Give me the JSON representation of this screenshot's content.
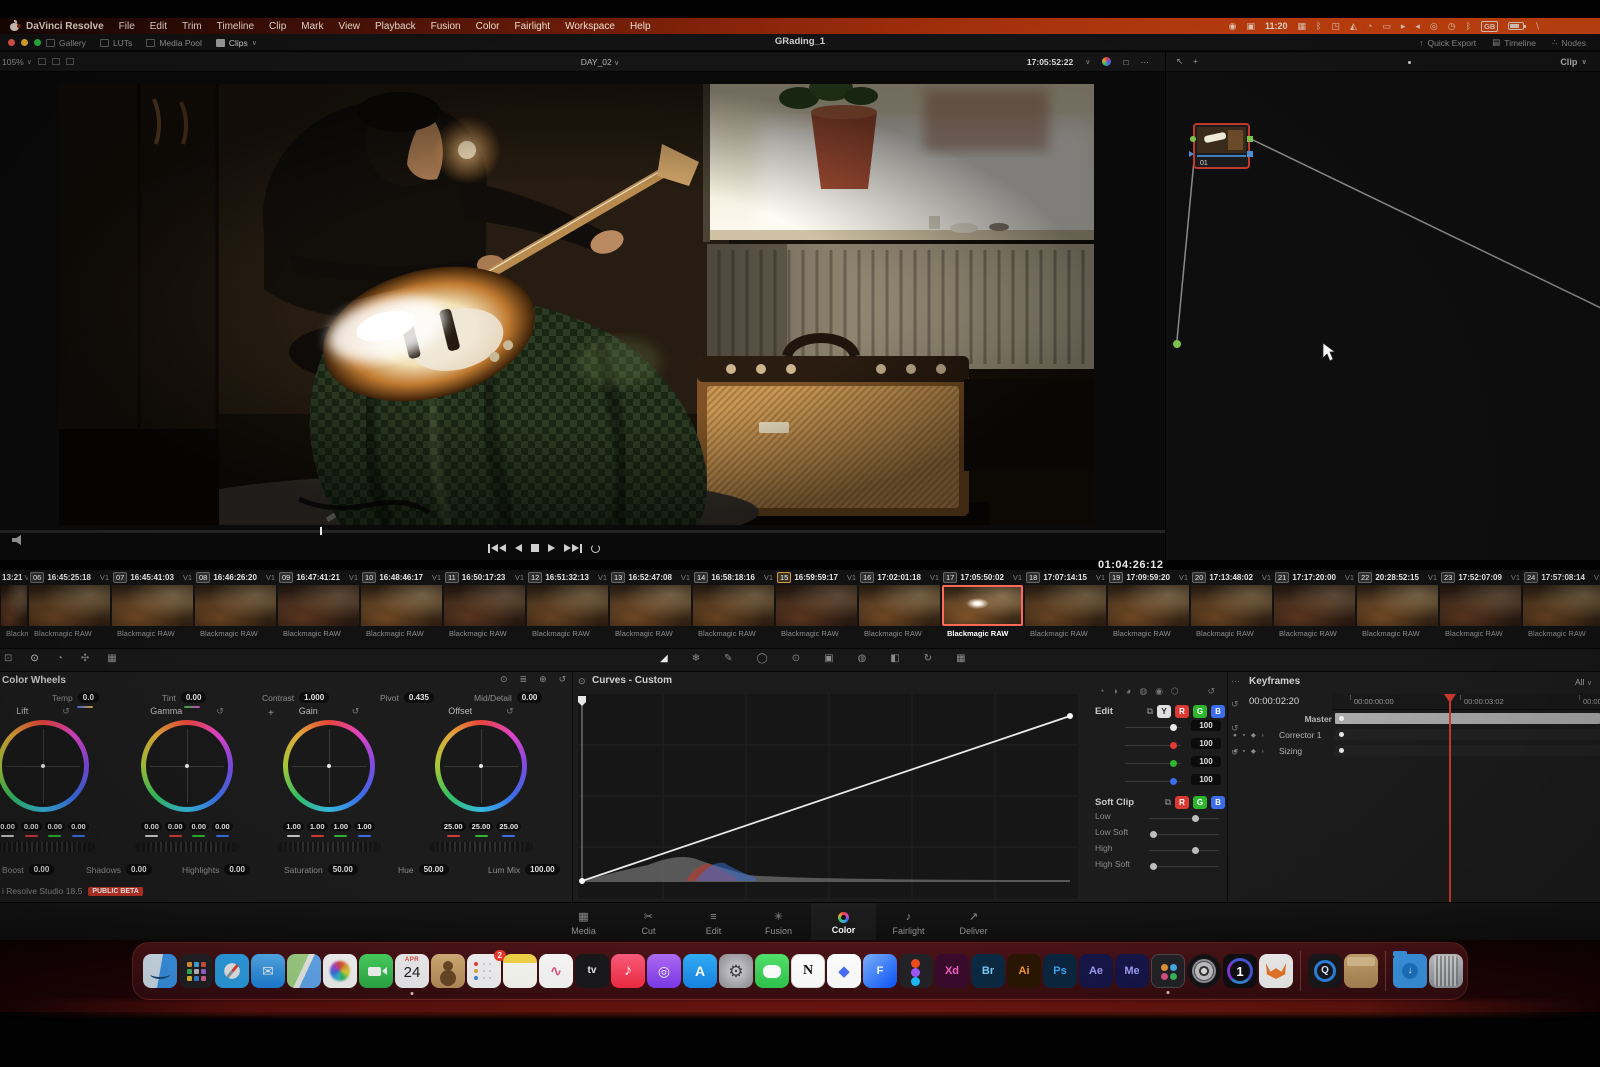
{
  "menu_bar": {
    "items": [
      "DaVinci Resolve",
      "File",
      "Edit",
      "Trim",
      "Timeline",
      "Clip",
      "Mark",
      "View",
      "Playback",
      "Fusion",
      "Color",
      "Fairlight",
      "Workspace",
      "Help"
    ],
    "status": [
      {
        "name": "creative-cloud-icon",
        "glyph": "◉"
      },
      {
        "name": "screen-record-icon",
        "glyph": "▣"
      },
      {
        "name": "menu-bar-time",
        "text": "11:20"
      },
      {
        "name": "stage-manager-icon",
        "glyph": "▦"
      },
      {
        "name": "bluetooth-icon",
        "glyph": "ᛒ"
      },
      {
        "name": "app-status-icon",
        "glyph": "◳"
      },
      {
        "name": "airdrop-icon",
        "glyph": "◭"
      },
      {
        "name": "pie-chart-icon",
        "glyph": "◔"
      },
      {
        "name": "display-icon",
        "glyph": "▭"
      },
      {
        "name": "play-status-icon",
        "glyph": "▸"
      },
      {
        "name": "volume-status-icon",
        "glyph": "◂"
      },
      {
        "name": "shortcuts-icon",
        "glyph": "◎"
      },
      {
        "name": "clock-icon",
        "glyph": "◷"
      },
      {
        "name": "bluetooth-2-icon",
        "glyph": "ᛒ"
      },
      {
        "name": "keyboard-layout",
        "text": "GB",
        "boxed": true
      },
      {
        "name": "battery-icon",
        "battery": true
      },
      {
        "name": "pen-icon",
        "glyph": "∖"
      }
    ]
  },
  "window_bar": {
    "title": "GRading_1",
    "left_buttons": [
      {
        "label": "Gallery"
      },
      {
        "label": "LUTs"
      },
      {
        "label": "Media Pool"
      },
      {
        "label": "Clips",
        "active": true,
        "dropdown": true
      }
    ],
    "right_buttons": [
      {
        "label": "Quick Export",
        "icon": "↑"
      },
      {
        "label": "Timeline",
        "icon": "▤"
      },
      {
        "label": "Nodes",
        "icon": "∴"
      }
    ]
  },
  "viewer": {
    "zoom": "105%",
    "timeline_name": "DAY_02",
    "timecode": "17:05:52:22",
    "record_timecode": "01:04:26:12"
  },
  "node_panel": {
    "header": "Clip",
    "node_label": "01"
  },
  "timeline": {
    "track": "V1",
    "format": "Blackmagic RAW",
    "clips": [
      {
        "tc": "13:21",
        "partial": true
      },
      {
        "num": "06",
        "tc": "16:45:25:18"
      },
      {
        "num": "07",
        "tc": "16:45:41:03"
      },
      {
        "num": "08",
        "tc": "16:46:26:20"
      },
      {
        "num": "09",
        "tc": "16:47:41:21"
      },
      {
        "num": "10",
        "tc": "16:48:46:17"
      },
      {
        "num": "11",
        "tc": "16:50:17:23"
      },
      {
        "num": "12",
        "tc": "16:51:32:13"
      },
      {
        "num": "13",
        "tc": "16:52:47:08"
      },
      {
        "num": "14",
        "tc": "16:58:18:16"
      },
      {
        "num": "15",
        "tc": "16:59:59:17",
        "marked": true
      },
      {
        "num": "16",
        "tc": "17:02:01:18"
      },
      {
        "num": "17",
        "tc": "17:05:50:02",
        "selected": true
      },
      {
        "num": "18",
        "tc": "17:07:14:15"
      },
      {
        "num": "19",
        "tc": "17:09:59:20"
      },
      {
        "num": "20",
        "tc": "17:13:48:02"
      },
      {
        "num": "21",
        "tc": "17:17:20:00"
      },
      {
        "num": "22",
        "tc": "20:28:52:15"
      },
      {
        "num": "23",
        "tc": "17:52:07:09"
      },
      {
        "num": "24",
        "tc": "17:57:08:14"
      }
    ]
  },
  "palette_icons": {
    "left": [
      "camera-raw",
      "color-wheels-mode",
      "hdr-wheels",
      "color-bars",
      "preview"
    ],
    "center": [
      "curves",
      "color-warper",
      "qualifier",
      "power-window",
      "tracker",
      "magic-mask",
      "blur",
      "key",
      "sizing",
      "stereo-3d"
    ]
  },
  "wheels": {
    "panel_title": "Color Wheels",
    "adjustments": [
      {
        "label": "Temp",
        "value": "0.0"
      },
      {
        "label": "Tint",
        "value": "0.00"
      },
      {
        "label": "Contrast",
        "value": "1.000"
      },
      {
        "label": "Pivot",
        "value": "0.435"
      },
      {
        "label": "Mid/Detail",
        "value": "0.00"
      }
    ],
    "wheels": [
      {
        "label": "Lift",
        "values": [
          "0.00",
          "0.00",
          "0.00",
          "0.00"
        ]
      },
      {
        "label": "Gamma",
        "values": [
          "0.00",
          "0.00",
          "0.00",
          "0.00"
        ]
      },
      {
        "label": "Gain",
        "values": [
          "1.00",
          "1.00",
          "1.00",
          "1.00"
        ]
      },
      {
        "label": "Offset",
        "values": [
          "25.00",
          "25.00",
          "25.00"
        ]
      }
    ],
    "bottom_adjustments": [
      {
        "label": "Boost",
        "value": "0.00"
      },
      {
        "label": "Shadows",
        "value": "0.00"
      },
      {
        "label": "Highlights",
        "value": "0.00"
      },
      {
        "label": "Saturation",
        "value": "50.00"
      },
      {
        "label": "Hue",
        "value": "50.00"
      },
      {
        "label": "Lum Mix",
        "value": "100.00"
      }
    ],
    "version": "i Resolve Studio 18.5",
    "beta_badge": "PUBLIC BETA"
  },
  "curves": {
    "panel_title": "Curves - Custom",
    "edit_label": "Edit",
    "channels": [
      "Y",
      "R",
      "G",
      "B"
    ],
    "channel_values": [
      "100",
      "100",
      "100",
      "100"
    ],
    "soft_clip_label": "Soft Clip",
    "soft_clip_channels": [
      "R",
      "G",
      "B"
    ],
    "soft_clip_rows": [
      {
        "label": "Low",
        "pos": 62
      },
      {
        "label": "Low Soft",
        "pos": 2
      },
      {
        "label": "High",
        "pos": 62
      },
      {
        "label": "High Soft",
        "pos": 2
      }
    ]
  },
  "keyframes": {
    "panel_title": "Keyframes",
    "filter": "All",
    "current_timecode": "00:00:02:20",
    "ruler_labels": [
      "00:00:00:00",
      "00:00:03:02",
      "00:00:0"
    ],
    "rows": [
      {
        "label": "Master",
        "master": true
      },
      {
        "label": "Corrector 1"
      },
      {
        "label": "Sizing"
      }
    ]
  },
  "pages": {
    "tabs": [
      {
        "label": "Media",
        "name": "media"
      },
      {
        "label": "Cut",
        "name": "cut"
      },
      {
        "label": "Edit",
        "name": "edit"
      },
      {
        "label": "Fusion",
        "name": "fusion"
      },
      {
        "label": "Color",
        "name": "color",
        "active": true
      },
      {
        "label": "Fairlight",
        "name": "fairlight"
      },
      {
        "label": "Deliver",
        "name": "deliver"
      }
    ]
  },
  "dock": {
    "items": [
      {
        "name": "finder"
      },
      {
        "name": "launchpad"
      },
      {
        "name": "safari"
      },
      {
        "name": "mail",
        "text": "✉"
      },
      {
        "name": "maps"
      },
      {
        "name": "photos"
      },
      {
        "name": "facetime"
      },
      {
        "name": "calendar",
        "month": "APR",
        "day": "24",
        "running": true
      },
      {
        "name": "contacts"
      },
      {
        "name": "reminders",
        "badge": "2"
      },
      {
        "name": "notes"
      },
      {
        "name": "freeform",
        "text": "∿"
      },
      {
        "name": "appletv",
        "text": "tv"
      },
      {
        "name": "music",
        "text": "♪"
      },
      {
        "name": "podcasts",
        "text": "◎"
      },
      {
        "name": "appstore",
        "text": "A"
      },
      {
        "name": "settings",
        "text": "⚙"
      },
      {
        "name": "messages"
      },
      {
        "name": "notion",
        "text": "N"
      },
      {
        "name": "craft",
        "text": "◆"
      },
      {
        "name": "framer",
        "text": "F"
      },
      {
        "name": "figma"
      },
      {
        "name": "adobe-xd",
        "text": "Xd"
      },
      {
        "name": "adobe-bridge",
        "text": "Br"
      },
      {
        "name": "adobe-illustrator",
        "text": "Ai"
      },
      {
        "name": "adobe-photoshop",
        "text": "Ps"
      },
      {
        "name": "adobe-aftereffects",
        "text": "Ae"
      },
      {
        "name": "adobe-mediaencoder",
        "text": "Me"
      },
      {
        "name": "davinci-resolve",
        "running": true
      },
      {
        "name": "film-reel"
      },
      {
        "name": "capture-one",
        "text": "1"
      },
      {
        "name": "fox-app"
      },
      {
        "sep": true
      },
      {
        "name": "quicktime",
        "text": "Q"
      },
      {
        "name": "unarchiver"
      },
      {
        "sep": true
      },
      {
        "name": "downloads",
        "text": "↓"
      },
      {
        "name": "trash"
      }
    ]
  }
}
